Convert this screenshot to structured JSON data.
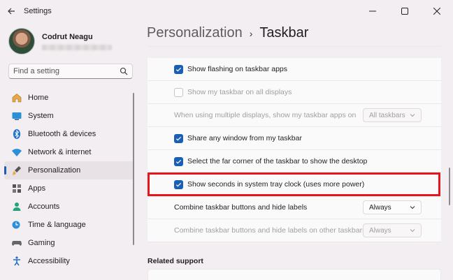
{
  "window": {
    "title": "Settings"
  },
  "profile": {
    "name": "Codrut Neagu"
  },
  "search": {
    "placeholder": "Find a setting"
  },
  "nav": [
    {
      "label": "Home",
      "icon": "home-icon",
      "active": false
    },
    {
      "label": "System",
      "icon": "system-icon",
      "active": false
    },
    {
      "label": "Bluetooth & devices",
      "icon": "bluetooth-icon",
      "active": false
    },
    {
      "label": "Network & internet",
      "icon": "network-icon",
      "active": false
    },
    {
      "label": "Personalization",
      "icon": "personalization-icon",
      "active": true
    },
    {
      "label": "Apps",
      "icon": "apps-icon",
      "active": false
    },
    {
      "label": "Accounts",
      "icon": "accounts-icon",
      "active": false
    },
    {
      "label": "Time & language",
      "icon": "time-language-icon",
      "active": false
    },
    {
      "label": "Gaming",
      "icon": "gaming-icon",
      "active": false
    },
    {
      "label": "Accessibility",
      "icon": "accessibility-icon",
      "active": false
    }
  ],
  "breadcrumb": {
    "parent": "Personalization",
    "separator": "›",
    "current": "Taskbar"
  },
  "settings": {
    "flashing": {
      "label": "Show flashing on taskbar apps",
      "checked": true
    },
    "all_displays": {
      "label": "Show my taskbar on all displays",
      "checked": false,
      "disabled": true
    },
    "multi_display": {
      "label": "When using multiple displays, show my taskbar apps on",
      "value": "All taskbars",
      "disabled": true
    },
    "share_window": {
      "label": "Share any window from my taskbar",
      "checked": true
    },
    "far_corner": {
      "label": "Select the far corner of the taskbar to show the desktop",
      "checked": true
    },
    "seconds": {
      "label": "Show seconds in system tray clock (uses more power)",
      "checked": true
    },
    "combine": {
      "label": "Combine taskbar buttons and hide labels",
      "value": "Always"
    },
    "combine_other": {
      "label": "Combine taskbar buttons and hide labels on other taskbars",
      "value": "Always",
      "disabled": true
    }
  },
  "related": {
    "title": "Related support"
  },
  "colors": {
    "accent": "#1a5fb4",
    "highlight": "#e8141c"
  }
}
